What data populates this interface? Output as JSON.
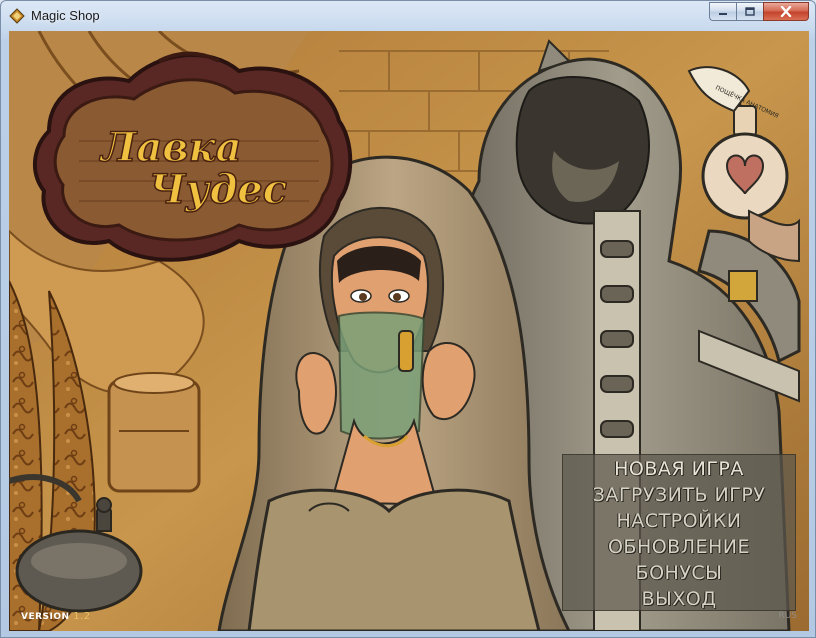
{
  "window": {
    "title": "Magic Shop",
    "icon": "magic-shop-app-icon",
    "controls": [
      "minimize-icon",
      "maximize-icon",
      "close-icon"
    ]
  },
  "logo": {
    "line1": "Лавка",
    "line2": "Чудес"
  },
  "potion_tag": "ПОЩЁЧКА АНАТОМИЯ",
  "menu": {
    "items": [
      {
        "label": "НОВАЯ ИГРА"
      },
      {
        "label": "ЗАГРУЗИТЬ ИГРУ"
      },
      {
        "label": "НАСТРОЙКИ"
      },
      {
        "label": "ОБНОВЛЕНИЕ"
      },
      {
        "label": "БОНУСЫ"
      },
      {
        "label": "ВЫХОД"
      }
    ]
  },
  "footer": {
    "version_label": "VERSION",
    "version_number": "1.2",
    "language": "RUS"
  },
  "colors": {
    "wall": "#c08a3e",
    "wood_frame": "#6a2f2a",
    "hood_tan": "#b09a78",
    "robe_grey": "#8f8a7c",
    "menu_text": "#d6d2c4",
    "version_number": "#e8c060"
  }
}
